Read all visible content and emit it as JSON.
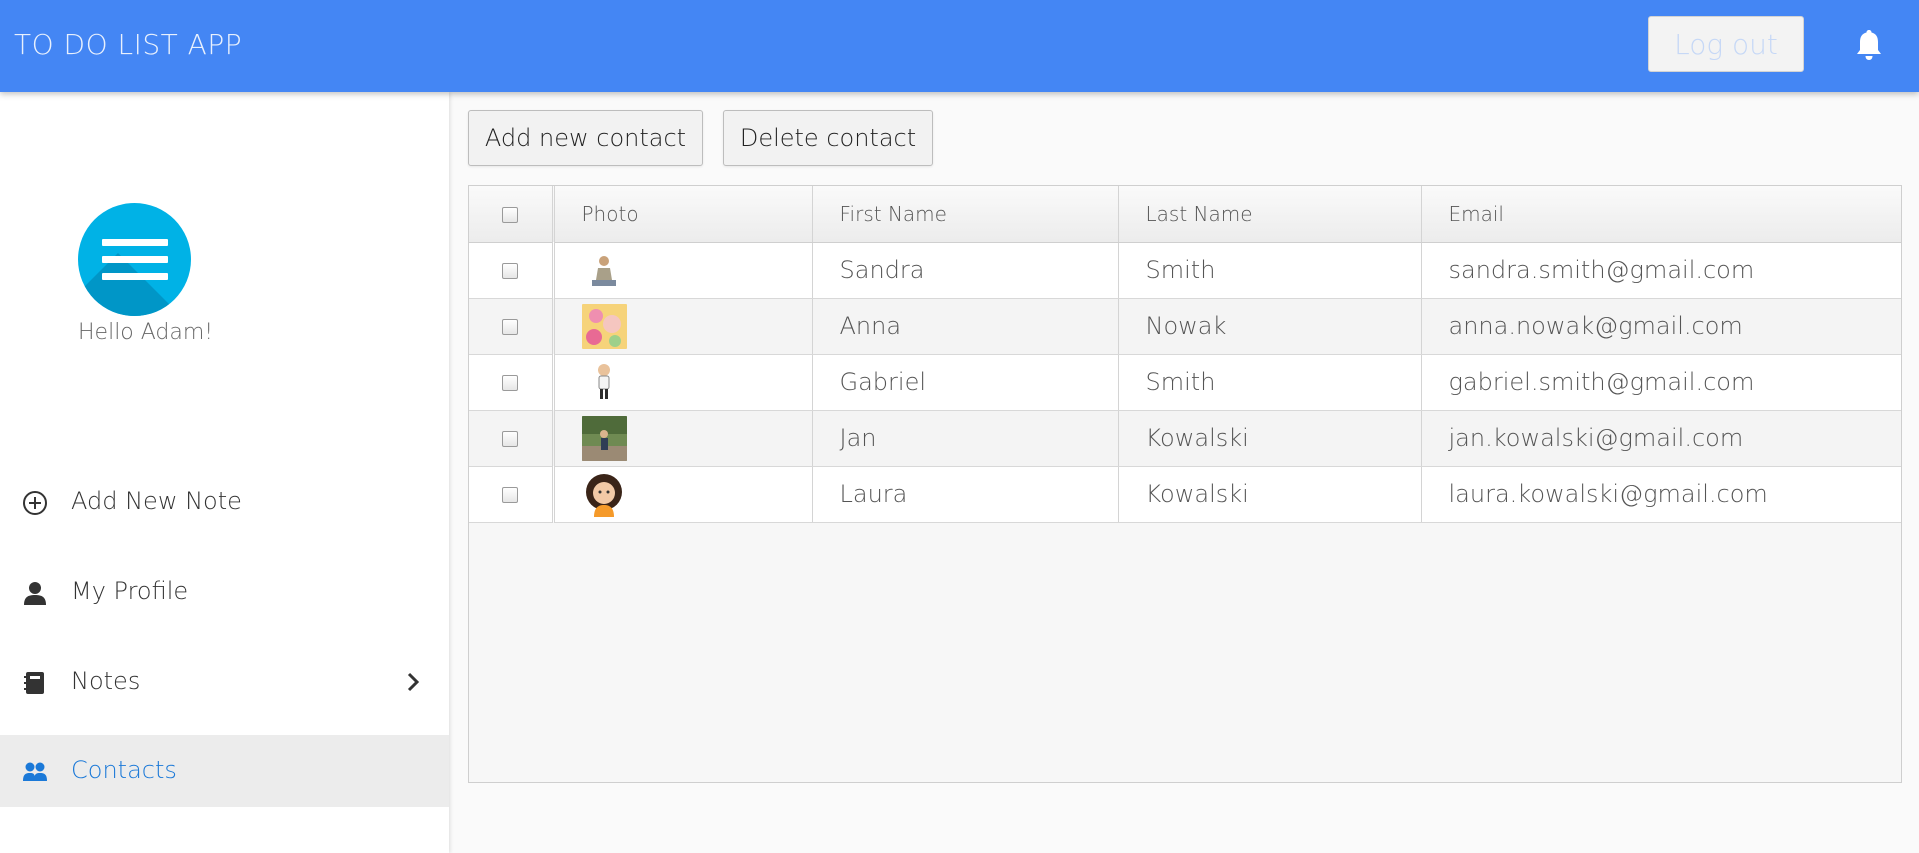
{
  "header": {
    "title": "TO DO LIST APP",
    "logout_label": "Log out"
  },
  "sidebar": {
    "greeting": "Hello Adam!",
    "items": [
      {
        "label": "Add New Note",
        "icon": "plus-circle-icon"
      },
      {
        "label": "My Profile",
        "icon": "person-icon"
      },
      {
        "label": "Notes",
        "icon": "notebook-icon"
      },
      {
        "label": "Contacts",
        "icon": "contacts-icon",
        "active": true
      }
    ]
  },
  "toolbar": {
    "add_label": "Add new contact",
    "delete_label": "Delete contact"
  },
  "table": {
    "columns": [
      "Photo",
      "First Name",
      "Last Name",
      "Email"
    ],
    "rows": [
      {
        "first": "Sandra",
        "last": "Smith",
        "email": "sandra.smith@gmail.com"
      },
      {
        "first": "Anna",
        "last": "Nowak",
        "email": "anna.nowak@gmail.com"
      },
      {
        "first": "Gabriel",
        "last": "Smith",
        "email": "gabriel.smith@gmail.com"
      },
      {
        "first": "Jan",
        "last": "Kowalski",
        "email": "jan.kowalski@gmail.com"
      },
      {
        "first": "Laura",
        "last": "Kowalski",
        "email": "laura.kowalski@gmail.com"
      }
    ]
  },
  "colors": {
    "header": "#4486f4",
    "active_link": "#1b79d8",
    "avatar": "#00b2e6"
  }
}
